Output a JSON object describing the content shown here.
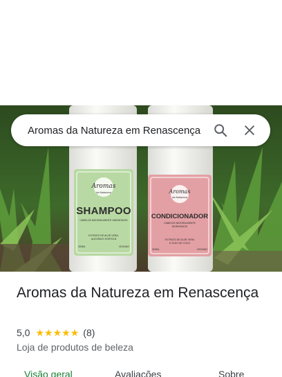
{
  "search": {
    "query": "Aromas da Natureza em Renascença",
    "search_icon": "search-icon",
    "clear_icon": "close-icon"
  },
  "photo": {
    "bottle_left": {
      "brand": "Aromas",
      "brand_sub": "da Natureza",
      "product": "SHAMPOO",
      "tagline": "CABELOS NATURALMENTE HIDRATADOS",
      "ingredients_line1": "EXTRATO DE ALOE VERA,",
      "ingredients_line2": "ALECRIM E HORTELÃ",
      "volume": "300ML",
      "vegan": "VEGANO"
    },
    "bottle_right": {
      "brand": "Aromas",
      "brand_sub": "da Natureza",
      "product": "CONDICIONADOR",
      "tagline_line1": "CABELOS NATURALMENTE",
      "tagline_line2": "HIDRATADOS",
      "ingredients_line1": "EXTRATO DE ALOE VERA",
      "ingredients_line2": "E ÓLEO DE COCO",
      "volume": "300ML",
      "vegan": "VEGANO"
    }
  },
  "place": {
    "name": "Aromas da Natureza em Renascença",
    "rating": "5,0",
    "stars": 5,
    "review_count": "(8)",
    "category": "Loja de produtos de beleza"
  },
  "tabs": [
    {
      "label": "Visão geral",
      "active": true
    },
    {
      "label": "Avaliações",
      "active": false
    },
    {
      "label": "Sobre",
      "active": false
    }
  ],
  "colors": {
    "accent": "#188038",
    "star": "#fbbc04",
    "shampoo_label": "#b8d9a3",
    "conditioner_label": "#e3a0a4"
  }
}
